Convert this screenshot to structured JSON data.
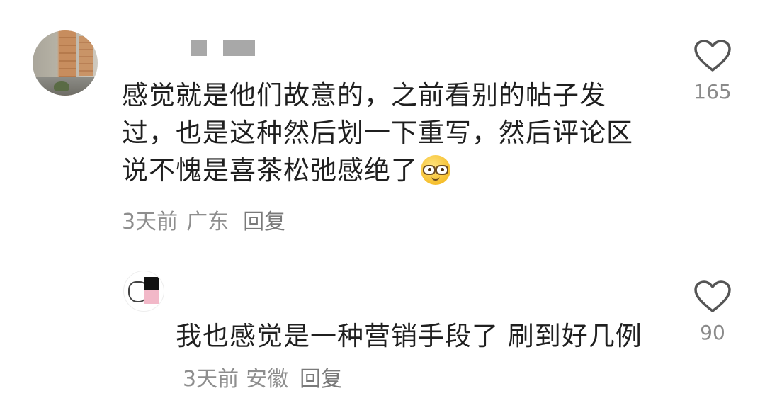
{
  "comments": [
    {
      "text": "感觉就是他们故意的，之前看别的帖子发过，也是这种然后划一下重写，然后评论区说不愧是喜茶松弛感绝了",
      "emoji": "glasses-smile-emoji",
      "time": "3天前",
      "location": "广东",
      "reply_label": "回复",
      "likes": "165",
      "like_icon": "heart-outline-icon"
    },
    {
      "text": "我也感觉是一种营销手段了 刷到好几例",
      "time": "3天前",
      "location": "安徽",
      "reply_label": "回复",
      "likes": "90",
      "like_icon": "heart-outline-icon"
    }
  ],
  "colors": {
    "text": "#1f1f1f",
    "meta": "#8e8e8e",
    "like_icon": "#555555",
    "background": "#ffffff"
  }
}
